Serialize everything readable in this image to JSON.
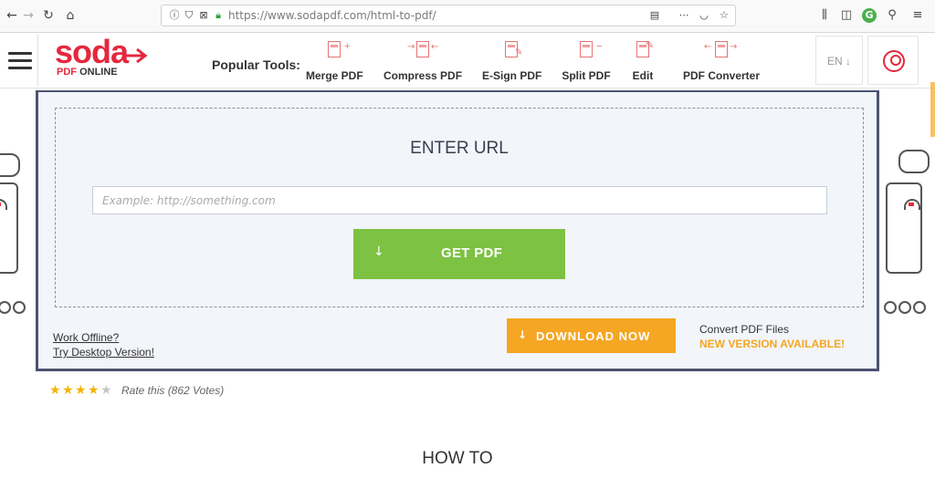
{
  "browser": {
    "url_domain": "https://www.sodapdf.com",
    "url_path": "/html-to-pdf/"
  },
  "header": {
    "logo_main": "soda",
    "logo_sub_pdf": "PDF",
    "logo_sub_online": "ONLINE",
    "popular_label": "Popular Tools:",
    "tools": [
      {
        "label": "Merge PDF"
      },
      {
        "label": "Compress PDF"
      },
      {
        "label": "E-Sign PDF"
      },
      {
        "label": "Split PDF"
      },
      {
        "label": "Edit"
      },
      {
        "label": "PDF Converter"
      }
    ],
    "language": "EN ↓"
  },
  "converter": {
    "heading": "ENTER URL",
    "input_placeholder": "Example: http://something.com",
    "input_value": "",
    "get_pdf_label": "GET PDF",
    "work_offline": "Work Offline?",
    "try_desktop": "Try Desktop Version!",
    "download_label": "DOWNLOAD NOW",
    "convert_files": "Convert PDF Files",
    "new_version": "NEW VERSION AVAILABLE!"
  },
  "rating": {
    "stars_filled": 4,
    "stars_total": 5,
    "text": "Rate this (862 Votes)"
  },
  "howto_heading": "HOW TO",
  "colors": {
    "brand_red": "#e5283d",
    "green_button": "#7dc242",
    "orange_button": "#f5a623",
    "panel_border": "#4c5370"
  }
}
